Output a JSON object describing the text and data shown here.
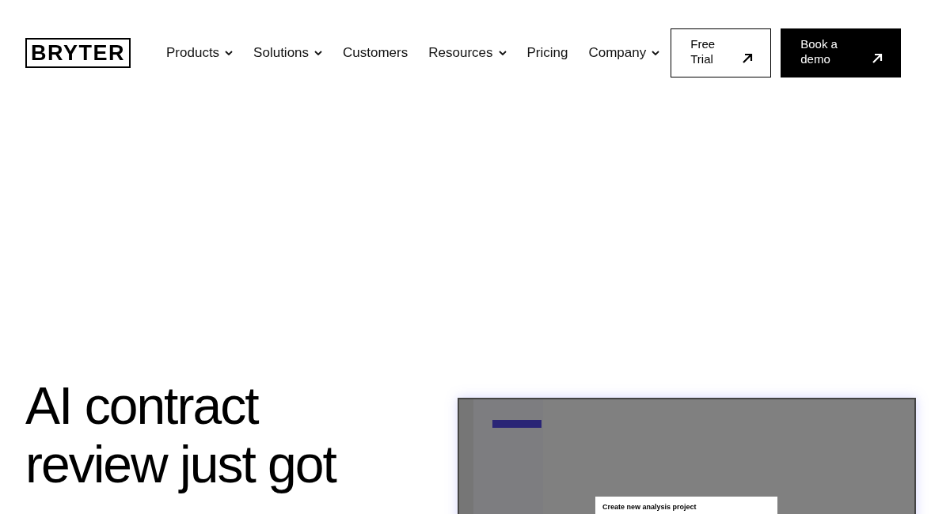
{
  "header": {
    "logo": "BRYTER",
    "nav": [
      {
        "label": "Products",
        "dropdown": true
      },
      {
        "label": "Solutions",
        "dropdown": true
      },
      {
        "label": "Customers",
        "dropdown": false
      },
      {
        "label": "Resources",
        "dropdown": true
      },
      {
        "label": "Pricing",
        "dropdown": false
      },
      {
        "label": "Company",
        "dropdown": true
      }
    ],
    "buttons": [
      {
        "label": "Free Trial",
        "kind": "outline"
      },
      {
        "label": "Book a demo",
        "kind": "solid"
      }
    ]
  },
  "hero": {
    "headline": "AI contract review just got",
    "app_preview": {
      "dialog_title": "Create new analysis project"
    }
  }
}
